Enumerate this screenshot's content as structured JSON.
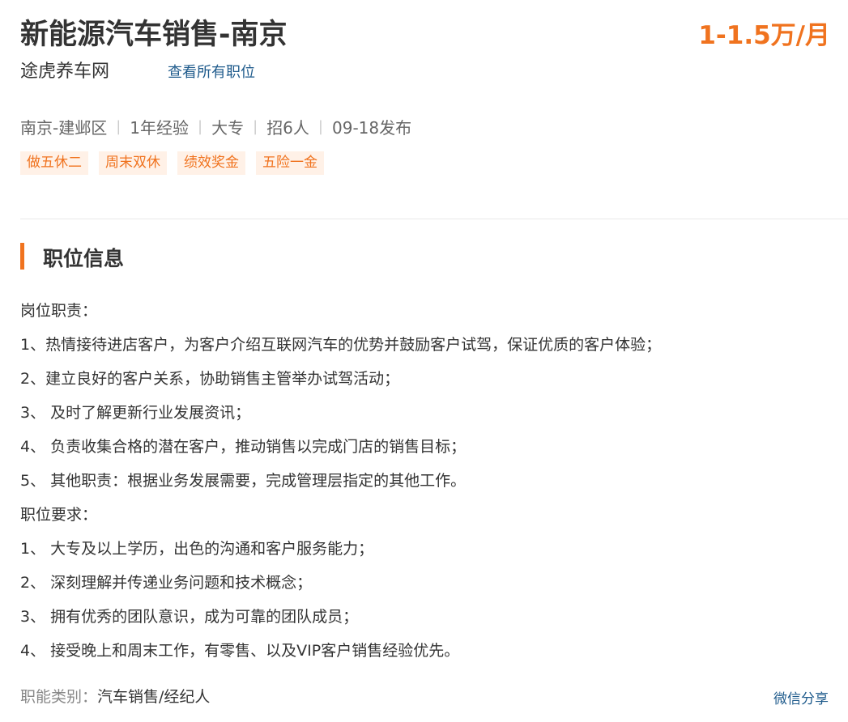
{
  "job": {
    "title": "新能源汽车销售-南京",
    "salary": "1-1.5万/月",
    "company": "途虎养车网",
    "view_all_jobs": "查看所有职位"
  },
  "meta": {
    "location": "南京-建邺区",
    "experience": "1年经验",
    "education": "大专",
    "headcount": "招6人",
    "posted": "09-18发布"
  },
  "tags": [
    "做五休二",
    "周末双休",
    "绩效奖金",
    "五险一金"
  ],
  "section": {
    "title": "职位信息"
  },
  "description": [
    "岗位职责：",
    "1、热情接待进店客户，为客户介绍互联网汽车的优势并鼓励客户试驾，保证优质的客户体验；",
    "2、建立良好的客户关系，协助销售主管举办试驾活动；",
    "3、 及时了解更新行业发展资讯；",
    "4、 负责收集合格的潜在客户，推动销售以完成门店的销售目标；",
    "5、 其他职责：根据业务发展需要，完成管理层指定的其他工作。",
    "职位要求：",
    "1、 大专及以上学历，出色的沟通和客户服务能力；",
    "2、 深刻理解并传递业务问题和技术概念；",
    "3、 拥有优秀的团队意识，成为可靠的团队成员；",
    "4、 接受晚上和周末工作，有零售、以及VIP客户销售经验优先。"
  ],
  "footer": {
    "category_label": "职能类别：",
    "category_value": "汽车销售/经纪人",
    "share": "微信分享"
  },
  "colors": {
    "accent": "#f0731f",
    "link": "#1f5b8c",
    "tag_bg": "#fff1e7"
  }
}
